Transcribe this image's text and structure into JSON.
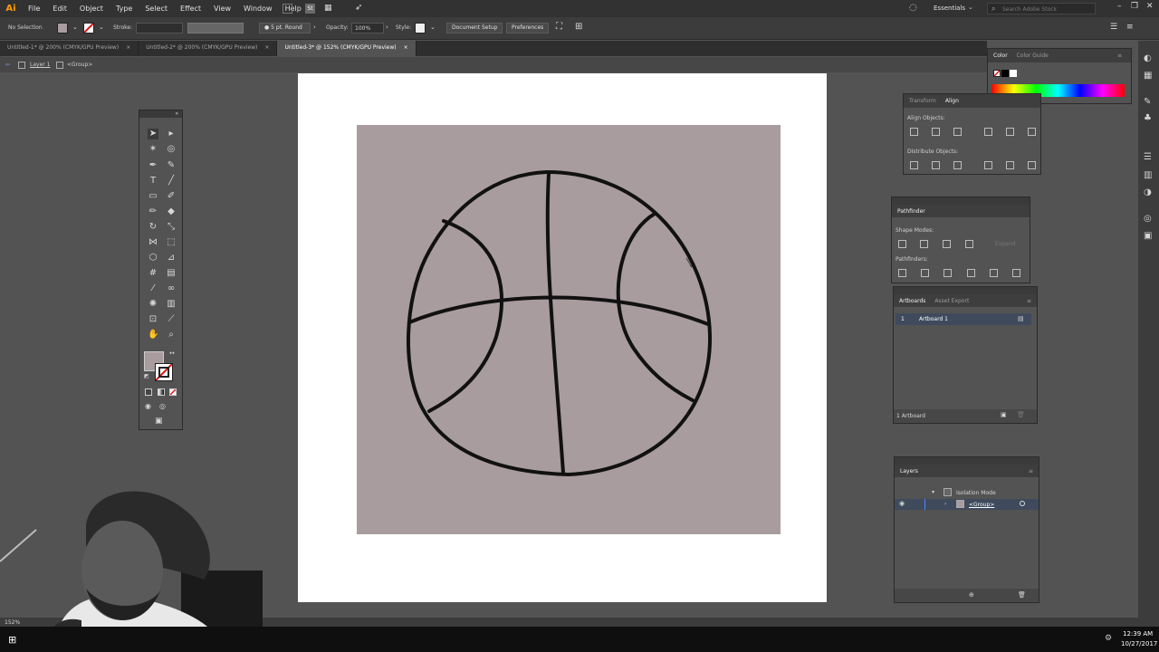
{
  "app": {
    "logo": "Ai"
  },
  "menu": [
    "File",
    "Edit",
    "Object",
    "Type",
    "Select",
    "Effect",
    "View",
    "Window",
    "Help"
  ],
  "workspace": "Essentials",
  "search_placeholder": "Search Adobe Stock",
  "control": {
    "selection": "No Selection",
    "stroke_label": "Stroke:",
    "brush": "5 pt. Round",
    "opacity_label": "Opacity:",
    "opacity_value": "100%",
    "style_label": "Style:",
    "document_setup": "Document Setup",
    "preferences": "Preferences"
  },
  "tabs": [
    {
      "label": "Untitled-1* @ 200% (CMYK/GPU Preview)",
      "close": "×"
    },
    {
      "label": "Untitled-2* @ 200% (CMYK/GPU Preview)",
      "close": "×"
    },
    {
      "label": "Untitled-3* @ 152% (CMYK/GPU Preview)",
      "close": "×"
    }
  ],
  "breadcrumb": {
    "layer": "Layer 1",
    "group": "<Group>"
  },
  "colors": {
    "artboard_fill": "#a89c9f",
    "stroke": "#111111",
    "accent": "#3d7bd7"
  },
  "color_panel": {
    "tab1": "Color",
    "tab2": "Color Guide"
  },
  "align_panel": {
    "tab1": "Transform",
    "tab2": "Align",
    "align_objects": "Align Objects:",
    "distribute_objects": "Distribute Objects:"
  },
  "pathfinder_panel": {
    "title": "Pathfinder",
    "shape_modes": "Shape Modes:",
    "pathfinders": "Pathfinders:",
    "expand": "Expand"
  },
  "artboards_panel": {
    "tab1": "Artboards",
    "tab2": "Asset Export",
    "row_number": "1",
    "row_name": "Artboard 1",
    "count": "1 Artboard"
  },
  "layers_panel": {
    "title": "Layers",
    "isolation": "Isolation Mode",
    "group": "<Group>"
  },
  "status": {
    "zoom": "152%"
  },
  "taskbar": {
    "time": "12:39 AM",
    "date": "10/27/2017"
  }
}
